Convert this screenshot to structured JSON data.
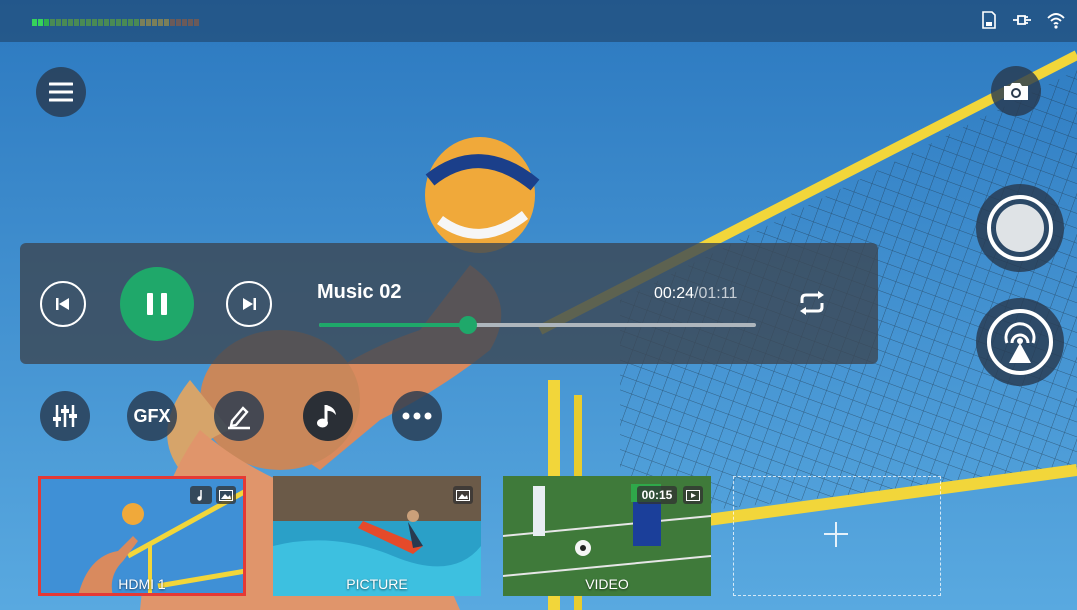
{
  "player": {
    "track_title": "Music 02",
    "current_time": "00:24",
    "total_time": "/01:11",
    "progress": 0.34
  },
  "tools": {
    "gfx_label": "GFX"
  },
  "sources": [
    {
      "label": "HDMI 1",
      "selected": true
    },
    {
      "label": "PICTURE",
      "selected": false
    },
    {
      "label": "VIDEO",
      "duration": "00:15",
      "selected": false
    },
    {
      "label": "",
      "empty": true
    }
  ],
  "colors": {
    "accent_green": "#1fa86a",
    "selection_red": "#e53935",
    "panel": "#3c4856"
  },
  "icons": [
    "menu-icon",
    "camera-icon",
    "record-icon",
    "broadcast-icon",
    "previous-icon",
    "pause-icon",
    "next-icon",
    "repeat-icon",
    "mixer-icon",
    "pen-icon",
    "music-note-icon",
    "more-icon",
    "add-icon"
  ]
}
